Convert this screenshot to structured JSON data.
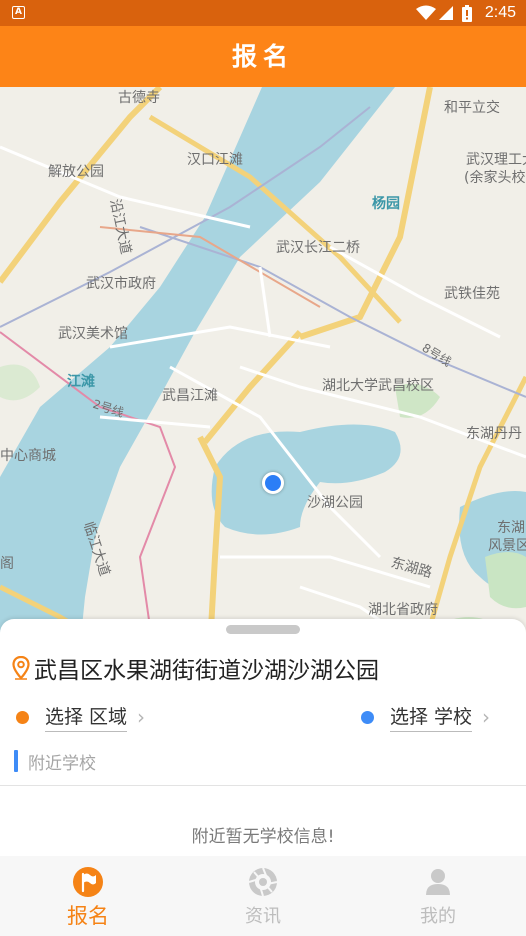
{
  "status_bar": {
    "time": "2:45",
    "app_badge": "A",
    "icons": [
      "wifi-icon",
      "cell-signal-icon",
      "battery-icon"
    ]
  },
  "header": {
    "title": "报名"
  },
  "map": {
    "labels": {
      "gu_de_si": "古德寺",
      "he_ping_li_jiao": "和平立交",
      "han_kou_jiang_tan": "汉口江滩",
      "jie_fang_gong_yuan": "解放公园",
      "yan_jiang_da_dao": "沿江大道",
      "wuhan_ligong": "武汉理工大",
      "yu_jia_tou": "(余家头校",
      "yang_yuan": "杨园",
      "changjiang_bridge_2": "武汉长江二桥",
      "wuhan_city_gov": "武汉市政府",
      "wu_tie_jia_yuan": "武铁佳苑",
      "wuhan_art_museum": "武汉美术馆",
      "line_8": "8号线",
      "jiang_tan": "江滩",
      "hubei_univ": "湖北大学武昌校区",
      "wuchang_jiang_tan": "武昌江滩",
      "line_2": "2号线",
      "donghu_danfeng": "东湖丹丹",
      "center_mall": "中心商城",
      "sha_hu_park": "沙湖公园",
      "lin_jiang_da_dao": "临江大道",
      "dong_hu_road": "东湖路",
      "donghu_scenic_1": "东湖",
      "donghu_scenic_2": "风景区",
      "ge": "阁",
      "hubei_gov": "湖北省政府"
    }
  },
  "location": {
    "address": "武昌区水果湖街街道沙湖沙湖公园"
  },
  "pickers": {
    "region_label": "选择 区域",
    "school_label": "选择 学校",
    "chevron": "›",
    "region_dot_color": "#f58316",
    "school_dot_color": "#3e8cf7"
  },
  "nearby": {
    "heading": "附近学校",
    "empty_message": "附近暂无学校信息!"
  },
  "tabbar": {
    "tabs": [
      {
        "label": "报名",
        "icon": "flag-icon",
        "active": true
      },
      {
        "label": "资讯",
        "icon": "aperture-icon",
        "active": false
      },
      {
        "label": "我的",
        "icon": "user-icon",
        "active": false
      }
    ]
  },
  "colors": {
    "brand_orange": "#fd8417",
    "status_bar": "#d9620d",
    "accent_blue": "#3e8cf7",
    "water": "#a8d4e0"
  }
}
